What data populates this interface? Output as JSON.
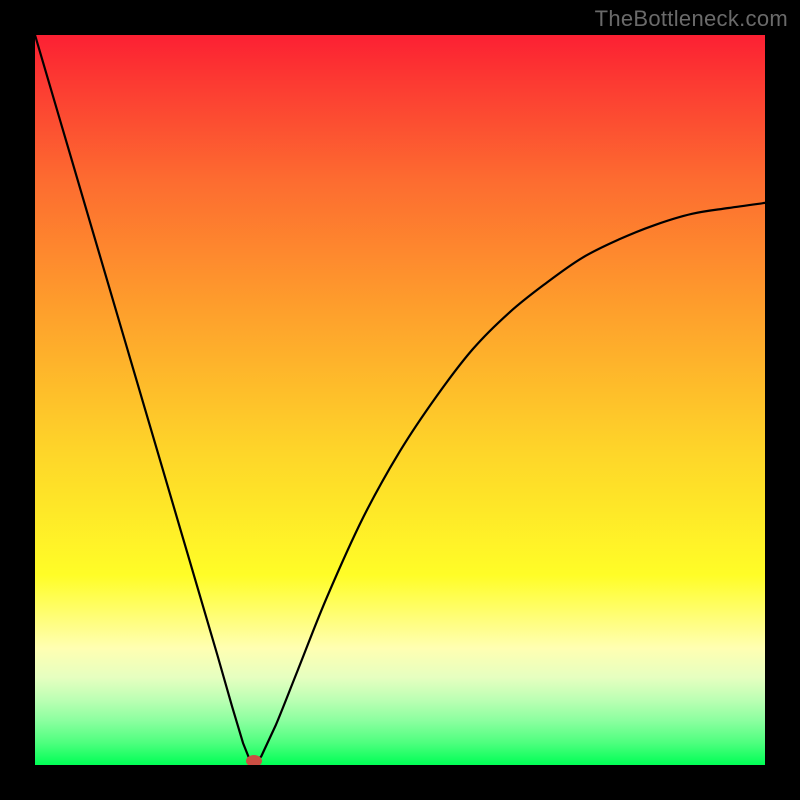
{
  "attribution": {
    "text": "TheBottleneck.com"
  },
  "chart_data": {
    "type": "line",
    "title": "",
    "xlabel": "",
    "ylabel": "",
    "xlim": [
      0,
      1
    ],
    "ylim": [
      0,
      1
    ],
    "series": [
      {
        "name": "curve",
        "x": [
          0.0,
          0.05,
          0.1,
          0.15,
          0.2,
          0.25,
          0.27,
          0.285,
          0.297,
          0.3,
          0.31,
          0.33,
          0.36,
          0.4,
          0.45,
          0.5,
          0.55,
          0.6,
          0.65,
          0.7,
          0.75,
          0.8,
          0.85,
          0.9,
          0.95,
          1.0
        ],
        "y": [
          1.0,
          0.83,
          0.66,
          0.49,
          0.32,
          0.15,
          0.08,
          0.03,
          0.0,
          0.0,
          0.012,
          0.055,
          0.13,
          0.23,
          0.34,
          0.43,
          0.505,
          0.57,
          0.62,
          0.66,
          0.695,
          0.72,
          0.74,
          0.755,
          0.763,
          0.77
        ]
      }
    ],
    "marker": {
      "x": 0.3,
      "y": 0.0,
      "color": "#cc4f43"
    },
    "background_gradient_stops": [
      {
        "pos": 0.0,
        "color": "#fc2033"
      },
      {
        "pos": 0.06,
        "color": "#fc3832"
      },
      {
        "pos": 0.2,
        "color": "#fd6c30"
      },
      {
        "pos": 0.38,
        "color": "#fea02c"
      },
      {
        "pos": 0.57,
        "color": "#fed529"
      },
      {
        "pos": 0.74,
        "color": "#fffd27"
      },
      {
        "pos": 0.84,
        "color": "#ffffb2"
      },
      {
        "pos": 0.88,
        "color": "#e6ffc0"
      },
      {
        "pos": 0.91,
        "color": "#bdffb4"
      },
      {
        "pos": 0.94,
        "color": "#8aff9f"
      },
      {
        "pos": 0.97,
        "color": "#4dff7e"
      },
      {
        "pos": 1.0,
        "color": "#00ff55"
      }
    ]
  }
}
